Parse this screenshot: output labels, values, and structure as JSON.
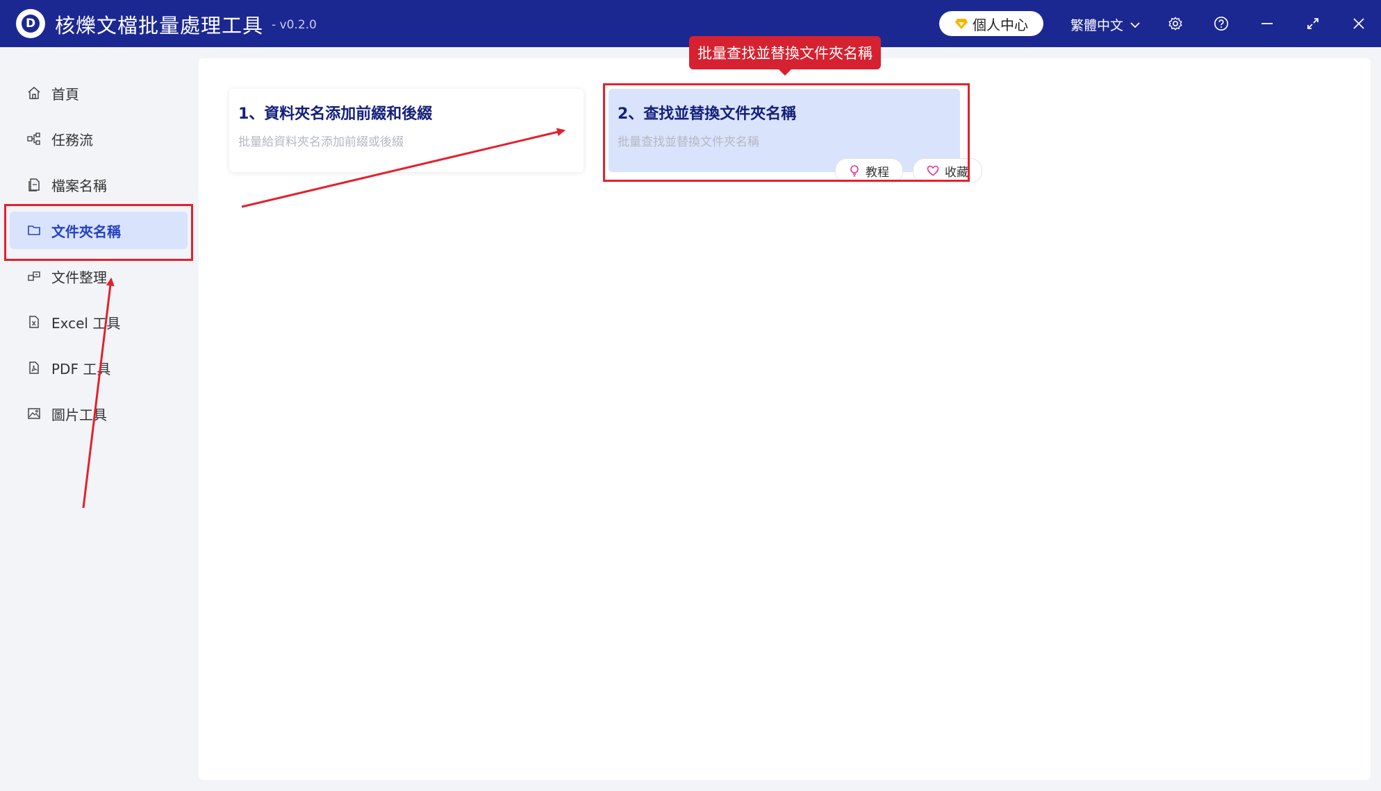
{
  "app": {
    "title": "核爍文檔批量處理工具",
    "version": "- v0.2.0",
    "personal_center": "個人中心",
    "language": "繁體中文"
  },
  "sidebar": {
    "items": [
      {
        "label": "首頁",
        "icon": "home-icon"
      },
      {
        "label": "任務流",
        "icon": "workflow-icon"
      },
      {
        "label": "檔案名稱",
        "icon": "file-icon"
      },
      {
        "label": "文件夾名稱",
        "icon": "folder-icon",
        "active": true
      },
      {
        "label": "文件整理",
        "icon": "organize-icon"
      },
      {
        "label": "Excel 工具",
        "icon": "excel-icon"
      },
      {
        "label": "PDF 工具",
        "icon": "pdf-icon"
      },
      {
        "label": "圖片工具",
        "icon": "image-icon"
      }
    ]
  },
  "cards": [
    {
      "title": "1、資料夾名添加前綴和後綴",
      "desc": "批量給資料夾名添加前綴或後綴"
    },
    {
      "title": "2、查找並替換文件夾名稱",
      "desc": "批量查找並替換文件夾名稱",
      "tutorial": "教程",
      "favorite": "收藏"
    }
  ],
  "annotation": {
    "tooltip": "批量查找並替換文件夾名稱"
  },
  "colors": {
    "titlebar": "#1c2891",
    "active_bg": "#d9e3fb",
    "accent": "#2442c2",
    "annotation_red": "#e3202c"
  }
}
